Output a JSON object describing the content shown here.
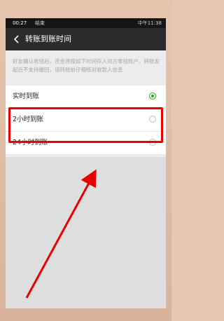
{
  "status": {
    "time": "00:27",
    "carrier": "结束",
    "right": "中午11:38"
  },
  "appbar": {
    "title": "转账到账时间"
  },
  "description": "好友确认收钱后，资金将按如下时间存入对方零钱账户。转账发起后不支持撤回，请转账前仔细核对收款人信息",
  "options": [
    {
      "label": "实时到账",
      "selected": true
    },
    {
      "label": "2小时到账",
      "selected": false
    },
    {
      "label": "24小时到账",
      "selected": false
    }
  ],
  "colors": {
    "accent": "#1aad19",
    "highlight": "#e60000",
    "appbar": "#2b2b2b"
  }
}
